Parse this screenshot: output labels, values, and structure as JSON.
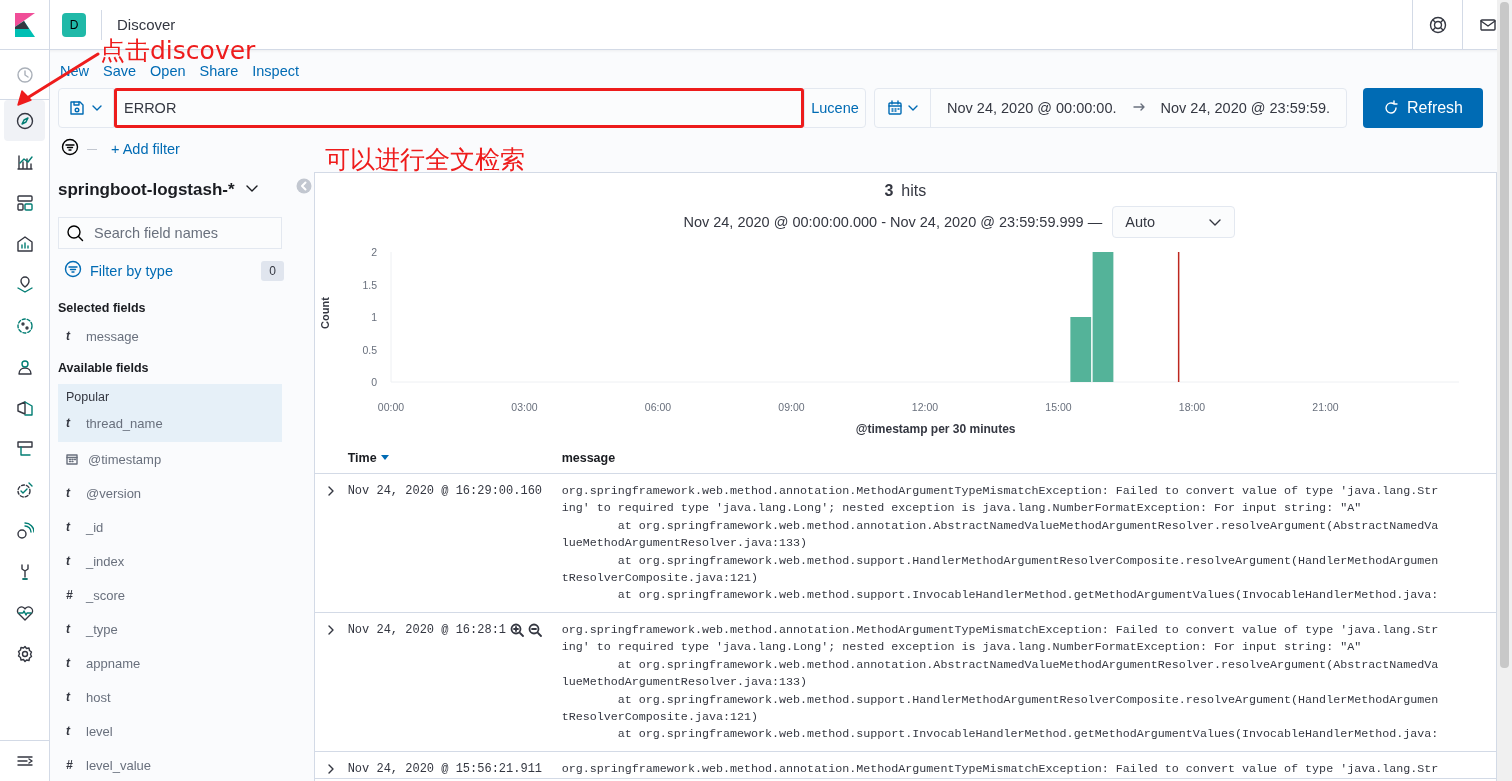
{
  "header": {
    "app_badge": "D",
    "title": "Discover"
  },
  "nav": [
    {
      "selected": false
    },
    {
      "selected": true
    },
    {
      "selected": false
    },
    {
      "selected": false
    },
    {
      "selected": false
    },
    {
      "selected": false
    },
    {
      "selected": false
    },
    {
      "selected": false
    },
    {
      "selected": false
    },
    {
      "selected": false
    },
    {
      "selected": false
    },
    {
      "selected": false
    },
    {
      "selected": false
    },
    {
      "selected": false
    },
    {
      "selected": false
    }
  ],
  "top_menu": [
    "New",
    "Save",
    "Open",
    "Share",
    "Inspect"
  ],
  "query": {
    "value": "ERROR",
    "language": "Lucene"
  },
  "time_range": {
    "start": "Nov 24, 2020 @ 00:00:00.",
    "end": "Nov 24, 2020 @ 23:59:59."
  },
  "refresh_button": "Refresh",
  "add_filter": "+ Add filter",
  "annotations": {
    "click_hint": "点击discover",
    "search_hint": "可以进行全文检索",
    "arrow": true,
    "query_box": true
  },
  "sidebar": {
    "index_pattern": "springboot-logstash-*",
    "search": {
      "placeholder": "Search field names"
    },
    "filter_by_type": {
      "label": "Filter by type",
      "count": "0"
    },
    "selected_fields_title": "Selected fields",
    "selected_fields": [
      {
        "type": "t",
        "name": "message"
      }
    ],
    "available_fields_title": "Available fields",
    "popular_title": "Popular",
    "popular_fields": [
      {
        "type": "t",
        "name": "thread_name"
      }
    ],
    "fields": [
      {
        "kind": "date",
        "name": "@timestamp"
      },
      {
        "type": "t",
        "name": "@version"
      },
      {
        "type": "t",
        "name": "_id"
      },
      {
        "type": "t",
        "name": "_index"
      },
      {
        "type": "#",
        "name": "_score"
      },
      {
        "type": "t",
        "name": "_type"
      },
      {
        "type": "t",
        "name": "appname"
      },
      {
        "type": "t",
        "name": "host"
      },
      {
        "type": "t",
        "name": "level"
      },
      {
        "type": "#",
        "name": "level_value"
      }
    ]
  },
  "results": {
    "hits": "3",
    "hits_label": "hits",
    "range": "Nov 24, 2020 @ 00:00:00.000 - Nov 24, 2020 @ 23:59:59.999 —",
    "interval": "Auto",
    "chart_data": {
      "type": "bar",
      "ylabel": "Count",
      "xlabel": "@timestamp per 30 minutes",
      "x": [
        15.5,
        16
      ],
      "values": [
        1,
        2
      ],
      "xlim": [
        0,
        24
      ],
      "ylim": [
        0,
        2
      ],
      "xticks": [
        {
          "value": 0,
          "label": "00:00"
        },
        {
          "value": 3,
          "label": "03:00"
        },
        {
          "value": 6,
          "label": "06:00"
        },
        {
          "value": 9,
          "label": "09:00"
        },
        {
          "value": 12,
          "label": "12:00"
        },
        {
          "value": 15,
          "label": "15:00"
        },
        {
          "value": 18,
          "label": "18:00"
        },
        {
          "value": 21,
          "label": "21:00"
        }
      ],
      "yticks": [
        0,
        0.5,
        1,
        1.5,
        2
      ],
      "ref_lines": [
        {
          "axis": "x",
          "value": 17.7,
          "color": "#bd271e"
        }
      ]
    }
  },
  "table": {
    "columns": [
      "Time",
      "message"
    ],
    "rows": [
      {
        "time": "Nov 24, 2020 @ 16:29:00.160",
        "hovered": false,
        "message_lines": [
          "org.springframework.web.method.annotation.MethodArgumentTypeMismatchException: Failed to convert value of type 'java.lang.Str",
          "ing' to required type 'java.lang.Long'; nested exception is java.lang.NumberFormatException: For input string: \"A\"",
          "        at org.springframework.web.method.annotation.AbstractNamedValueMethodArgumentResolver.resolveArgument(AbstractNamedVa",
          "lueMethodArgumentResolver.java:133)",
          "        at org.springframework.web.method.support.HandlerMethodArgumentResolverComposite.resolveArgument(HandlerMethodArgumen",
          "tResolverComposite.java:121)",
          "        at org.springframework.web.method.support.InvocableHandlerMethod.getMethodArgumentValues(InvocableHandlerMethod.java:"
        ]
      },
      {
        "time": "Nov 24, 2020 @ 16:28:1",
        "hovered": true,
        "message_lines": [
          "org.springframework.web.method.annotation.MethodArgumentTypeMismatchException: Failed to convert value of type 'java.lang.Str",
          "ing' to required type 'java.lang.Long'; nested exception is java.lang.NumberFormatException: For input string: \"A\"",
          "        at org.springframework.web.method.annotation.AbstractNamedValueMethodArgumentResolver.resolveArgument(AbstractNamedVa",
          "lueMethodArgumentResolver.java:133)",
          "        at org.springframework.web.method.support.HandlerMethodArgumentResolverComposite.resolveArgument(HandlerMethodArgumen",
          "tResolverComposite.java:121)",
          "        at org.springframework.web.method.support.InvocableHandlerMethod.getMethodArgumentValues(InvocableHandlerMethod.java:"
        ]
      },
      {
        "time": "Nov 24, 2020 @ 15:56:21.911",
        "hovered": false,
        "message_lines": [
          "org.springframework.web.method.annotation.MethodArgumentTypeMismatchException: Failed to convert value of type 'java.lang.Str"
        ]
      }
    ]
  }
}
